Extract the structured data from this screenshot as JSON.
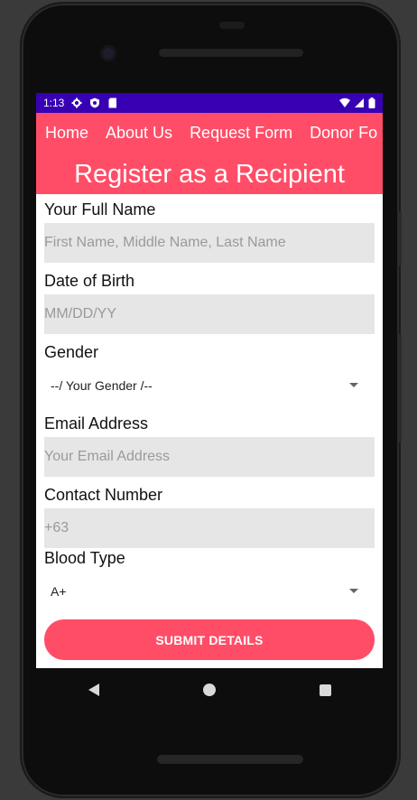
{
  "status_bar": {
    "time": "1:13",
    "background": "#3700b3"
  },
  "nav": {
    "items": [
      "Home",
      "About Us",
      "Request Form",
      "Donor Fo"
    ]
  },
  "page_title": "Register as a Recipient",
  "brand_color": "#ff4d67",
  "form": {
    "full_name": {
      "label": "Your Full Name",
      "placeholder": "First Name, Middle Name, Last Name"
    },
    "dob": {
      "label": "Date of Birth",
      "placeholder": "MM/DD/YY"
    },
    "gender": {
      "label": "Gender",
      "value": "--/ Your Gender /--"
    },
    "email": {
      "label": "Email Address",
      "placeholder": "Your Email Address"
    },
    "contact": {
      "label": "Contact Number",
      "placeholder": "+63"
    },
    "blood_type": {
      "label": "Blood Type",
      "value": "A+"
    },
    "submit_label": "SUBMIT DETAILS"
  },
  "icons": [
    "settings-icon",
    "shield-icon",
    "sd-card-icon",
    "wifi-icon",
    "signal-icon",
    "battery-icon",
    "back-icon",
    "home-icon",
    "recents-icon"
  ]
}
